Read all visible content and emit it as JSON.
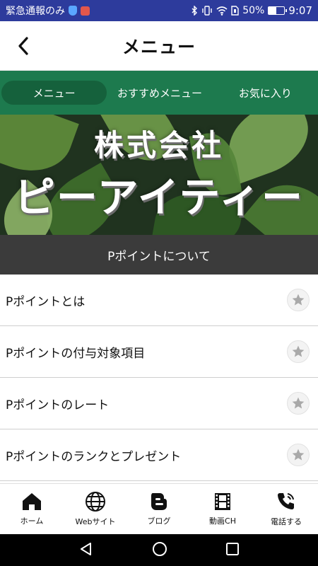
{
  "status_bar": {
    "left_text": "緊急通報のみ",
    "battery_percent": "50%",
    "battery_level": 0.5,
    "time": "9:07"
  },
  "header": {
    "title": "メニュー",
    "back_icon": "chevron-left-icon"
  },
  "tabs": [
    {
      "label": "メニュー",
      "active": true
    },
    {
      "label": "おすすめメニュー",
      "active": false
    },
    {
      "label": "お気に入り",
      "active": false
    }
  ],
  "banner": {
    "line1": "株式会社",
    "line2": "ピーアイティー"
  },
  "section": {
    "title": "Pポイントについて"
  },
  "items": [
    {
      "label": "Pポイントとは",
      "icon": "star-icon"
    },
    {
      "label": "Pポイントの付与対象項目",
      "icon": "star-icon"
    },
    {
      "label": "Pポイントのレート",
      "icon": "star-icon"
    },
    {
      "label": "Pポイントのランクとプレゼント",
      "icon": "star-icon"
    }
  ],
  "bottom_nav": [
    {
      "label": "ホーム",
      "icon": "home-icon"
    },
    {
      "label": "Webサイト",
      "icon": "globe-icon"
    },
    {
      "label": "ブログ",
      "icon": "blogger-icon"
    },
    {
      "label": "動画CH",
      "icon": "film-icon"
    },
    {
      "label": "電話する",
      "icon": "phone-icon"
    }
  ],
  "colors": {
    "status_bar": "#2d3b9c",
    "tab_bar": "#1d7a4e",
    "tab_active": "#15613c",
    "section_header": "#3b3b3b",
    "star": "#a9a9a9"
  }
}
